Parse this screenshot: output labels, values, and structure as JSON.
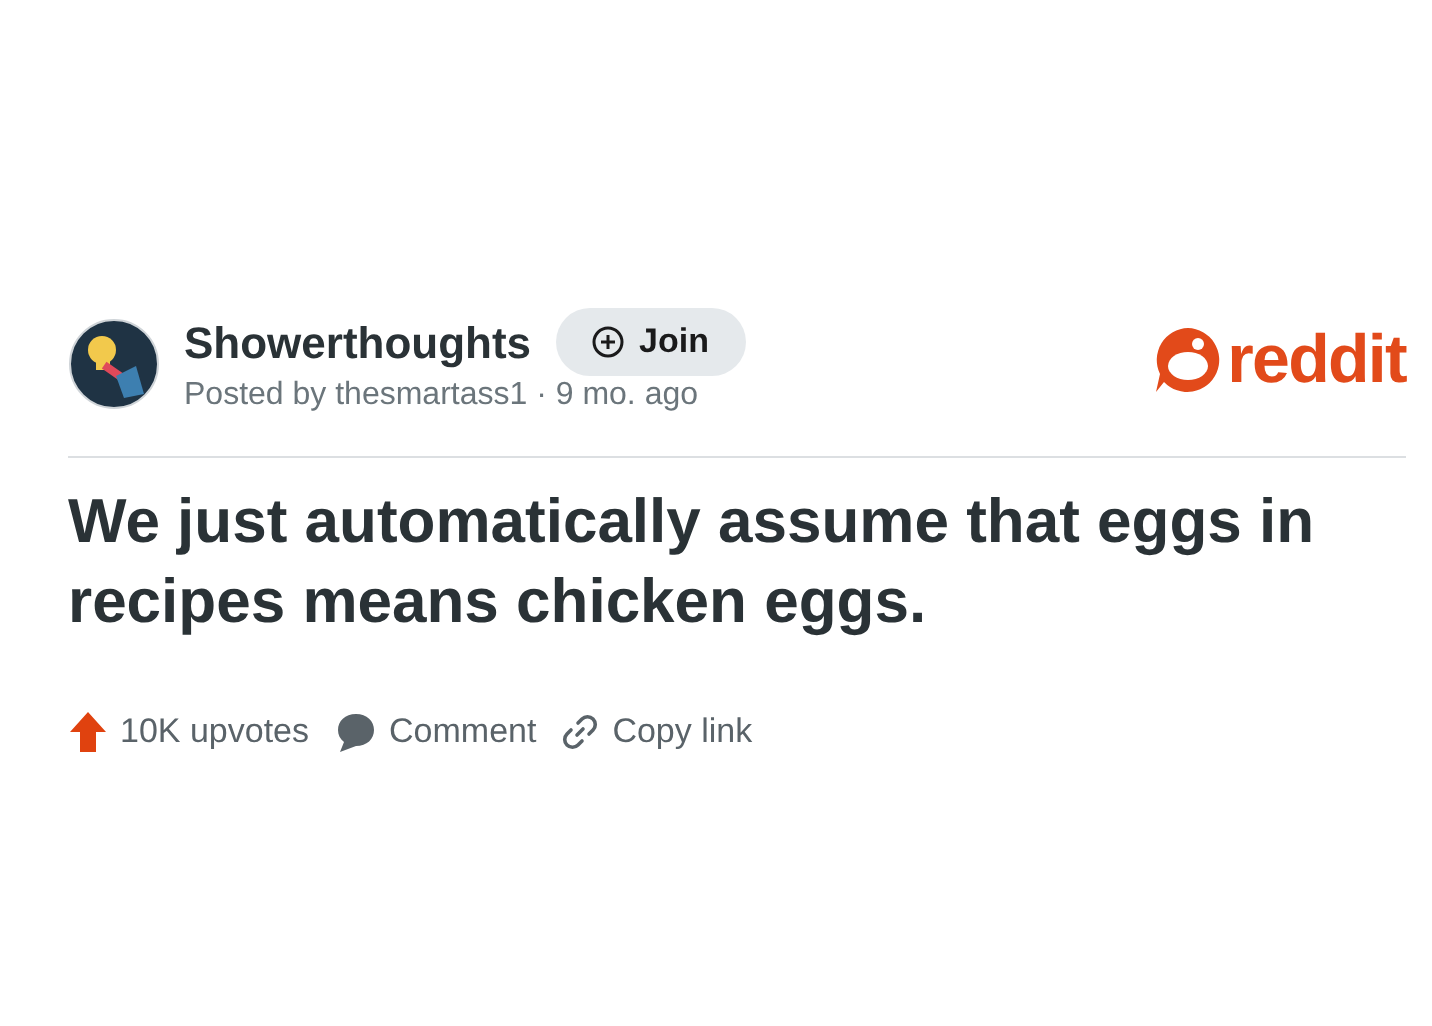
{
  "post": {
    "community": "Showerthoughts",
    "join_label": "Join",
    "meta": "Posted by thesmartass1 · 9 mo. ago",
    "title": "We just automatically assume that eggs in recipes means chicken eggs.",
    "actions": [
      {
        "kind": "upvote",
        "label": "10K upvotes"
      },
      {
        "kind": "comment",
        "label": "Comment"
      },
      {
        "kind": "link",
        "label": "Copy link"
      }
    ]
  },
  "brand": {
    "wordmark": "reddit"
  }
}
